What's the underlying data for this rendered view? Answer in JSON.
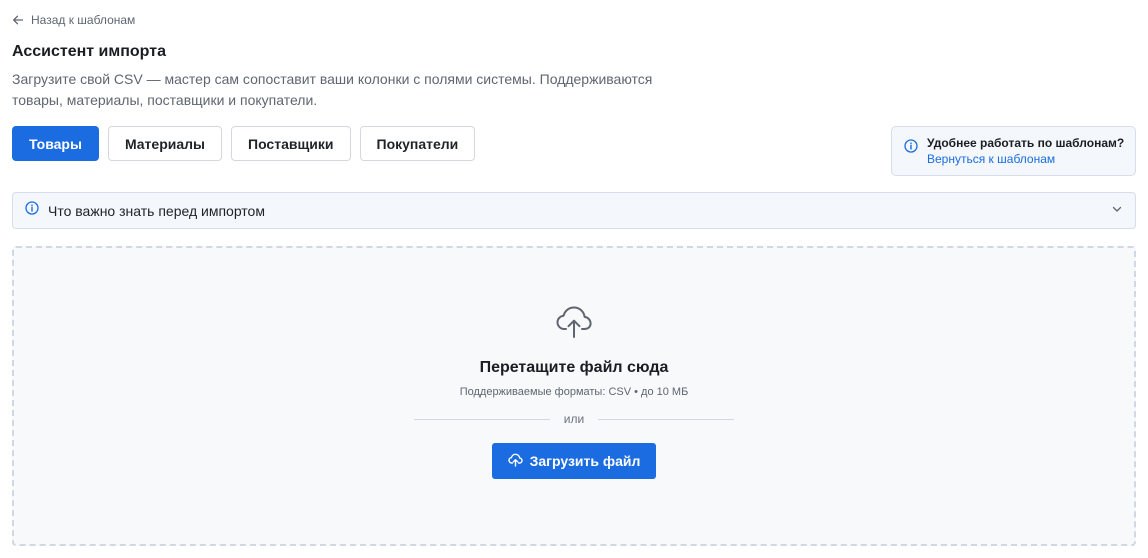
{
  "nav": {
    "back_label": "Назад к шаблонам"
  },
  "header": {
    "title": "Ассистент импорта",
    "subtitle": "Загрузите свой CSV — мастер сам сопоставит ваши колонки с полями системы. Поддерживаются товары, материалы, поставщики и покупатели."
  },
  "tabs": [
    {
      "label": "Товары",
      "active": true
    },
    {
      "label": "Материалы",
      "active": false
    },
    {
      "label": "Поставщики",
      "active": false
    },
    {
      "label": "Покупатели",
      "active": false
    }
  ],
  "hint": {
    "title": "Удобнее работать по шаблонам?",
    "link": "Вернуться к шаблонам",
    "icon": "info-icon"
  },
  "accordion": {
    "label": "Что важно знать перед импортом",
    "icon": "info-icon",
    "expanded": false
  },
  "dropzone": {
    "icon": "cloud-upload-icon",
    "title": "Перетащите файл сюда",
    "formats": "Поддерживаемые форматы: CSV • до 10 МБ",
    "or_label": "или",
    "button_label": "Загрузить файл"
  },
  "colors": {
    "accent": "#1a6ce0",
    "panel_bg": "#f4f7fb",
    "dropzone_border": "#cfd8e3"
  }
}
